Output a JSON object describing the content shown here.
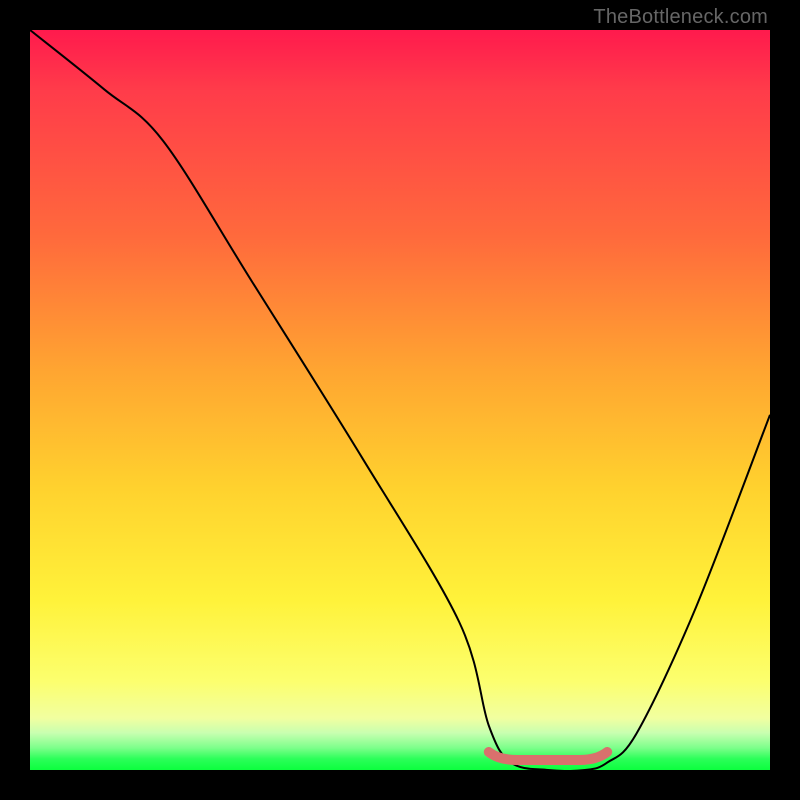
{
  "watermark": "TheBottleneck.com",
  "colors": {
    "accent": "#d9706d",
    "line": "#000000",
    "background_black": "#000000"
  },
  "chart_data": {
    "type": "line",
    "title": "",
    "xlabel": "",
    "ylabel": "",
    "xlim": [
      0,
      100
    ],
    "ylim": [
      0,
      100
    ],
    "grid": false,
    "legend": false,
    "series": [
      {
        "name": "bottleneck-curve",
        "x": [
          0,
          10,
          18,
          30,
          45,
          58,
          62,
          65,
          70,
          75,
          78,
          82,
          90,
          100
        ],
        "y": [
          100,
          92,
          85,
          66,
          42,
          20,
          6,
          1,
          0,
          0,
          1,
          5,
          22,
          48
        ]
      }
    ],
    "highlight": {
      "name": "optimal-range",
      "x_start": 62,
      "x_end": 78,
      "y": 0.5
    },
    "notes": "Y estimated from vertical position inside gradient (top=100, bottom=0). X estimated from horizontal position inside plot (left=0, right=100)."
  }
}
